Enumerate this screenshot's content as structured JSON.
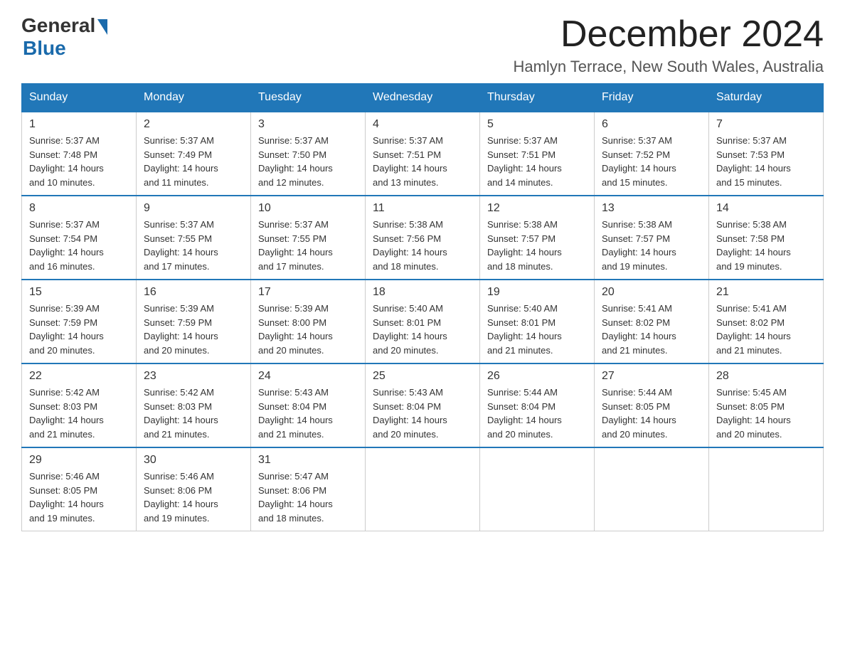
{
  "logo": {
    "text_general": "General",
    "text_blue": "Blue"
  },
  "title": "December 2024",
  "location": "Hamlyn Terrace, New South Wales, Australia",
  "days_of_week": [
    "Sunday",
    "Monday",
    "Tuesday",
    "Wednesday",
    "Thursday",
    "Friday",
    "Saturday"
  ],
  "weeks": [
    [
      {
        "day": "1",
        "sunrise": "5:37 AM",
        "sunset": "7:48 PM",
        "daylight": "14 hours and 10 minutes."
      },
      {
        "day": "2",
        "sunrise": "5:37 AM",
        "sunset": "7:49 PM",
        "daylight": "14 hours and 11 minutes."
      },
      {
        "day": "3",
        "sunrise": "5:37 AM",
        "sunset": "7:50 PM",
        "daylight": "14 hours and 12 minutes."
      },
      {
        "day": "4",
        "sunrise": "5:37 AM",
        "sunset": "7:51 PM",
        "daylight": "14 hours and 13 minutes."
      },
      {
        "day": "5",
        "sunrise": "5:37 AM",
        "sunset": "7:51 PM",
        "daylight": "14 hours and 14 minutes."
      },
      {
        "day": "6",
        "sunrise": "5:37 AM",
        "sunset": "7:52 PM",
        "daylight": "14 hours and 15 minutes."
      },
      {
        "day": "7",
        "sunrise": "5:37 AM",
        "sunset": "7:53 PM",
        "daylight": "14 hours and 15 minutes."
      }
    ],
    [
      {
        "day": "8",
        "sunrise": "5:37 AM",
        "sunset": "7:54 PM",
        "daylight": "14 hours and 16 minutes."
      },
      {
        "day": "9",
        "sunrise": "5:37 AM",
        "sunset": "7:55 PM",
        "daylight": "14 hours and 17 minutes."
      },
      {
        "day": "10",
        "sunrise": "5:37 AM",
        "sunset": "7:55 PM",
        "daylight": "14 hours and 17 minutes."
      },
      {
        "day": "11",
        "sunrise": "5:38 AM",
        "sunset": "7:56 PM",
        "daylight": "14 hours and 18 minutes."
      },
      {
        "day": "12",
        "sunrise": "5:38 AM",
        "sunset": "7:57 PM",
        "daylight": "14 hours and 18 minutes."
      },
      {
        "day": "13",
        "sunrise": "5:38 AM",
        "sunset": "7:57 PM",
        "daylight": "14 hours and 19 minutes."
      },
      {
        "day": "14",
        "sunrise": "5:38 AM",
        "sunset": "7:58 PM",
        "daylight": "14 hours and 19 minutes."
      }
    ],
    [
      {
        "day": "15",
        "sunrise": "5:39 AM",
        "sunset": "7:59 PM",
        "daylight": "14 hours and 20 minutes."
      },
      {
        "day": "16",
        "sunrise": "5:39 AM",
        "sunset": "7:59 PM",
        "daylight": "14 hours and 20 minutes."
      },
      {
        "day": "17",
        "sunrise": "5:39 AM",
        "sunset": "8:00 PM",
        "daylight": "14 hours and 20 minutes."
      },
      {
        "day": "18",
        "sunrise": "5:40 AM",
        "sunset": "8:01 PM",
        "daylight": "14 hours and 20 minutes."
      },
      {
        "day": "19",
        "sunrise": "5:40 AM",
        "sunset": "8:01 PM",
        "daylight": "14 hours and 21 minutes."
      },
      {
        "day": "20",
        "sunrise": "5:41 AM",
        "sunset": "8:02 PM",
        "daylight": "14 hours and 21 minutes."
      },
      {
        "day": "21",
        "sunrise": "5:41 AM",
        "sunset": "8:02 PM",
        "daylight": "14 hours and 21 minutes."
      }
    ],
    [
      {
        "day": "22",
        "sunrise": "5:42 AM",
        "sunset": "8:03 PM",
        "daylight": "14 hours and 21 minutes."
      },
      {
        "day": "23",
        "sunrise": "5:42 AM",
        "sunset": "8:03 PM",
        "daylight": "14 hours and 21 minutes."
      },
      {
        "day": "24",
        "sunrise": "5:43 AM",
        "sunset": "8:04 PM",
        "daylight": "14 hours and 21 minutes."
      },
      {
        "day": "25",
        "sunrise": "5:43 AM",
        "sunset": "8:04 PM",
        "daylight": "14 hours and 20 minutes."
      },
      {
        "day": "26",
        "sunrise": "5:44 AM",
        "sunset": "8:04 PM",
        "daylight": "14 hours and 20 minutes."
      },
      {
        "day": "27",
        "sunrise": "5:44 AM",
        "sunset": "8:05 PM",
        "daylight": "14 hours and 20 minutes."
      },
      {
        "day": "28",
        "sunrise": "5:45 AM",
        "sunset": "8:05 PM",
        "daylight": "14 hours and 20 minutes."
      }
    ],
    [
      {
        "day": "29",
        "sunrise": "5:46 AM",
        "sunset": "8:05 PM",
        "daylight": "14 hours and 19 minutes."
      },
      {
        "day": "30",
        "sunrise": "5:46 AM",
        "sunset": "8:06 PM",
        "daylight": "14 hours and 19 minutes."
      },
      {
        "day": "31",
        "sunrise": "5:47 AM",
        "sunset": "8:06 PM",
        "daylight": "14 hours and 18 minutes."
      },
      null,
      null,
      null,
      null
    ]
  ],
  "labels": {
    "sunrise": "Sunrise:",
    "sunset": "Sunset:",
    "daylight": "Daylight:"
  }
}
